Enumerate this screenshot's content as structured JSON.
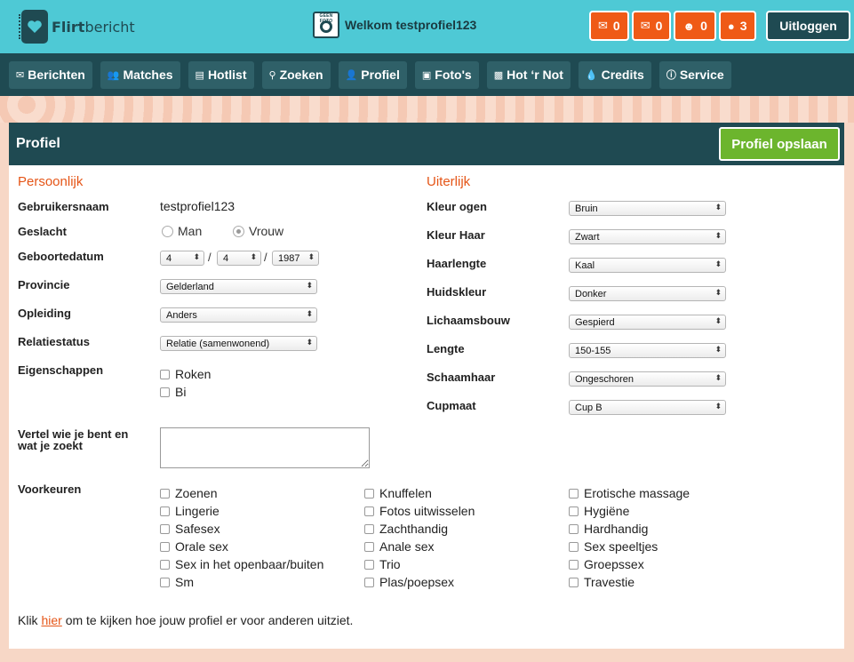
{
  "header": {
    "logo_strong": "Flirt",
    "logo_rest": "bericht",
    "camera_label": "GEEN FOTO",
    "welcome": "Welkom testprofiel123",
    "counters": [
      {
        "icon": "mail-icon",
        "value": "0"
      },
      {
        "icon": "mail-out-icon",
        "value": "0"
      },
      {
        "icon": "users-icon",
        "value": "0"
      },
      {
        "icon": "drop-icon",
        "value": "3"
      }
    ],
    "logout": "Uitloggen"
  },
  "nav": [
    {
      "label": "Berichten",
      "icon": "✉"
    },
    {
      "label": "Matches",
      "icon": "👥"
    },
    {
      "label": "Hotlist",
      "icon": "▤"
    },
    {
      "label": "Zoeken",
      "icon": "⚲"
    },
    {
      "label": "Profiel",
      "icon": "👤"
    },
    {
      "label": "Foto's",
      "icon": "▣"
    },
    {
      "label": "Hot ‘r Not",
      "icon": "▩"
    },
    {
      "label": "Credits",
      "icon": "💧"
    },
    {
      "label": "Service",
      "icon": "ⓘ"
    }
  ],
  "panel": {
    "title": "Profiel",
    "save": "Profiel opslaan"
  },
  "personal": {
    "title": "Persoonlijk",
    "username_label": "Gebruikersnaam",
    "username": "testprofiel123",
    "gender_label": "Geslacht",
    "gender_man": "Man",
    "gender_woman": "Vrouw",
    "birth_label": "Geboortedatum",
    "birth_day": "4",
    "birth_month": "4",
    "birth_year": "1987",
    "province_label": "Provincie",
    "province": "Gelderland",
    "education_label": "Opleiding",
    "education": "Anders",
    "relation_label": "Relatiestatus",
    "relation": "Relatie (samenwonend)",
    "traits_label": "Eigenschappen",
    "trait_smoke": "Roken",
    "trait_bi": "Bi",
    "about_label_1": "Vertel wie je bent en",
    "about_label_2": "wat je zoekt"
  },
  "appearance": {
    "title": "Uiterlijk",
    "rows": [
      {
        "label": "Kleur ogen",
        "value": "Bruin"
      },
      {
        "label": "Kleur Haar",
        "value": "Zwart"
      },
      {
        "label": "Haarlengte",
        "value": "Kaal"
      },
      {
        "label": "Huidskleur",
        "value": "Donker"
      },
      {
        "label": "Lichaamsbouw",
        "value": "Gespierd"
      },
      {
        "label": "Lengte",
        "value": "150-155"
      },
      {
        "label": "Schaamhaar",
        "value": "Ongeschoren"
      },
      {
        "label": "Cupmaat",
        "value": "Cup B"
      }
    ]
  },
  "preferences": {
    "label": "Voorkeuren",
    "col1": [
      "Zoenen",
      "Lingerie",
      "Safesex",
      "Orale sex",
      "Sex in het openbaar/buiten",
      "Sm"
    ],
    "col2": [
      "Knuffelen",
      "Fotos uitwisselen",
      "Zachthandig",
      "Anale sex",
      "Trio",
      "Plas/poepsex"
    ],
    "col3": [
      "Erotische massage",
      "Hygiëne",
      "Hardhandig",
      "Sex speeltjes",
      "Groepssex",
      "Travestie"
    ]
  },
  "footer": {
    "before": "Klik ",
    "link": "hier",
    "after": " om te kijken hoe jouw profiel er voor anderen uitziet."
  },
  "colors": {
    "topbar": "#4ec9d5",
    "dark": "#1f4a52",
    "orange": "#ef5a16",
    "green": "#6cb52d",
    "accent_text": "#e55517"
  }
}
